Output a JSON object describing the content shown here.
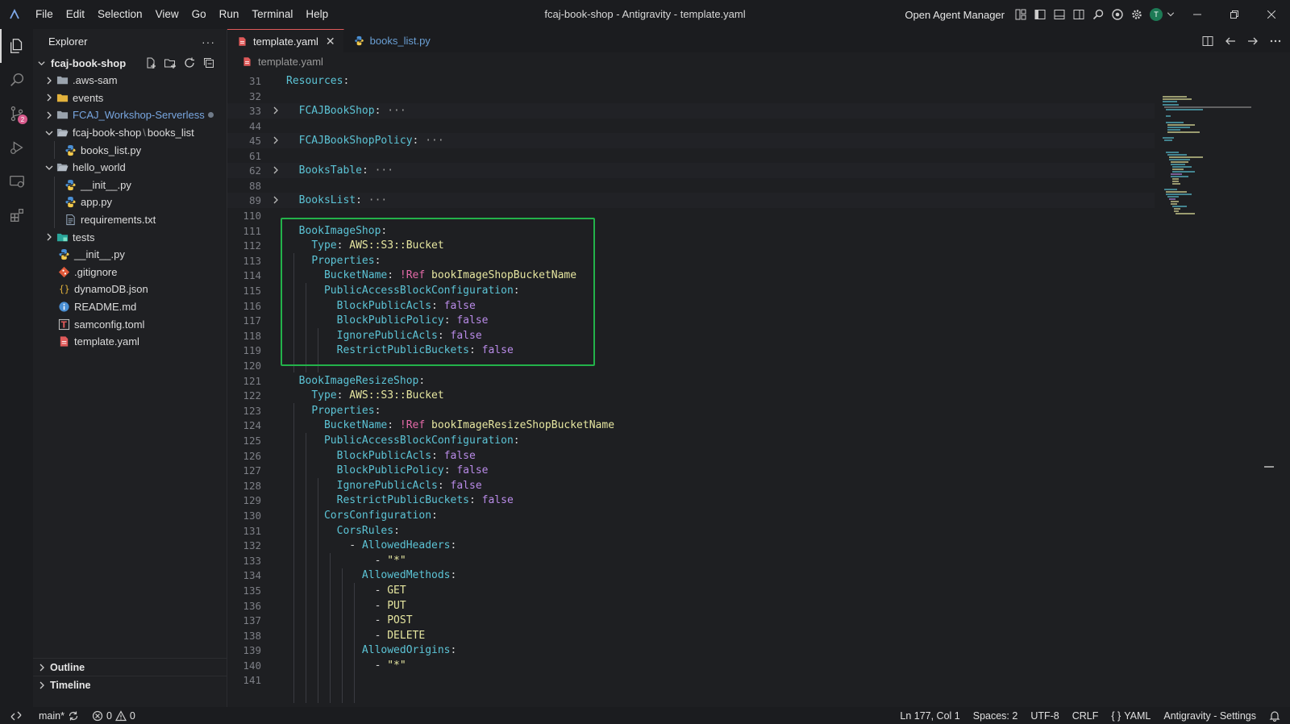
{
  "titlebar": {
    "menus": [
      "File",
      "Edit",
      "Selection",
      "View",
      "Go",
      "Run",
      "Terminal",
      "Help"
    ],
    "window_title": "fcaj-book-shop - Antigravity - template.yaml",
    "agent_manager": "Open Agent Manager",
    "avatar_letter": "T"
  },
  "activitybar": {
    "items": [
      "explorer-icon",
      "search-icon",
      "source-control-icon",
      "run-debug-icon",
      "remote-explorer-icon",
      "extensions-icon"
    ],
    "scm_badge": "2"
  },
  "sidebar": {
    "title": "Explorer",
    "more": "···",
    "root": "fcaj-book-shop",
    "items": [
      {
        "label": ".aws-sam",
        "kind": "folder"
      },
      {
        "label": "events",
        "kind": "folder"
      },
      {
        "label": "FCAJ_Workshop-Serverless",
        "kind": "folder"
      },
      {
        "label": "fcaj-book-shop",
        "sep": "\\",
        "label2": "books_list",
        "kind": "folder"
      },
      {
        "label": "books_list.py",
        "kind": "python"
      },
      {
        "label": "hello_world",
        "kind": "folder"
      },
      {
        "label": "__init__.py",
        "kind": "python"
      },
      {
        "label": "app.py",
        "kind": "python"
      },
      {
        "label": "requirements.txt",
        "kind": "text"
      },
      {
        "label": "tests",
        "kind": "folder"
      },
      {
        "label": "__init__.py",
        "kind": "python"
      },
      {
        "label": ".gitignore",
        "kind": "git"
      },
      {
        "label": "dynamoDB.json",
        "kind": "json"
      },
      {
        "label": "README.md",
        "kind": "info"
      },
      {
        "label": "samconfig.toml",
        "kind": "toml"
      },
      {
        "label": "template.yaml",
        "kind": "yaml"
      }
    ],
    "outline": "Outline",
    "timeline": "Timeline"
  },
  "editor": {
    "tabs": [
      {
        "label": "template.yaml",
        "active": true
      },
      {
        "label": "books_list.py",
        "active": false
      }
    ],
    "breadcrumb": "template.yaml",
    "line_numbers": [
      "31",
      "32",
      "33",
      "44",
      "45",
      "61",
      "62",
      "88",
      "89",
      "110",
      "111",
      "112",
      "113",
      "114",
      "115",
      "116",
      "117",
      "118",
      "119",
      "120",
      "121",
      "122",
      "123",
      "124",
      "125",
      "126",
      "127",
      "128",
      "129",
      "130",
      "131",
      "132",
      "133",
      "134",
      "135",
      "136",
      "137",
      "138",
      "139",
      "140",
      "141"
    ],
    "code": {
      "l31_key": "Resources",
      "l33_key": "FCAJBookShop",
      "l45_key": "FCAJBookShopPolicy",
      "l62_key": "BooksTable",
      "l89_key": "BooksList",
      "ellipsis": "···",
      "l111_key": "BookImageShop",
      "type_key": "Type",
      "type_val": "AWS::S3::Bucket",
      "props_key": "Properties",
      "bucket_key": "BucketName",
      "ref_tag": "!Ref",
      "l114_val": "bookImageShopBucketName",
      "pab_key": "PublicAccessBlockConfiguration",
      "bpa_key": "BlockPublicAcls",
      "bpp_key": "BlockPublicPolicy",
      "ipa_key": "IgnorePublicAcls",
      "rpb_key": "RestrictPublicBuckets",
      "false_val": "false",
      "l121_key": "BookImageResizeShop",
      "l124_val": "bookImageResizeShopBucketName",
      "cors_key": "CorsConfiguration",
      "rules_key": "CorsRules",
      "headers_key": "AllowedHeaders",
      "star_val": "\"*\"",
      "methods_key": "AllowedMethods",
      "m_get": "GET",
      "m_put": "PUT",
      "m_post": "POST",
      "m_delete": "DELETE",
      "origins_key": "AllowedOrigins"
    }
  },
  "statusbar": {
    "branch": "main*",
    "errors": "0",
    "warnings": "0",
    "position": "Ln 177, Col 1",
    "spaces": "Spaces: 2",
    "encoding": "UTF-8",
    "eol": "CRLF",
    "language": "YAML",
    "settings": "Antigravity - Settings"
  },
  "colors": {
    "highlight_box": "#23b24a",
    "key": "#5cc4d6",
    "string": "#e6e6a0",
    "boolean": "#b98be8",
    "tag": "#e46aa8"
  }
}
